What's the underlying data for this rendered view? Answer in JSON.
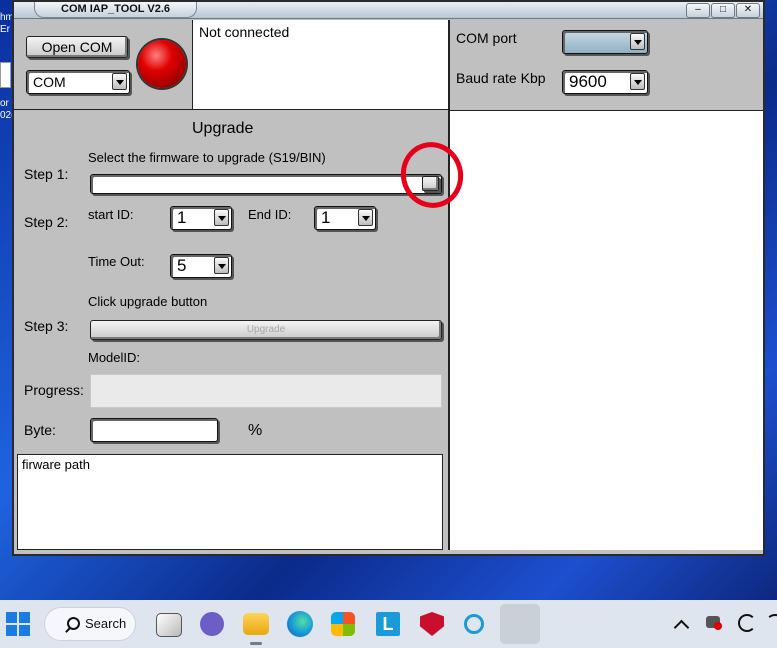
{
  "desktop": {
    "fragments": [
      "hm",
      "Er",
      "or l",
      "02("
    ]
  },
  "window": {
    "title": "COM IAP_TOOL V2.6",
    "controls": {
      "minimize": "–",
      "maximize": "□",
      "close": "✕"
    }
  },
  "connection": {
    "open_com_label": "Open COM",
    "com_select_value": "COM",
    "status_text": "Not connected",
    "status_color": "#d40000"
  },
  "port_settings": {
    "com_port_label": "COM port",
    "com_port_value": "",
    "baud_rate_label": "Baud rate Kbp",
    "baud_rate_value": "9600"
  },
  "upgrade": {
    "heading": "Upgrade",
    "step1_label": "Step 1:",
    "step1_text": "Select the firmware  to upgrade (S19/BIN)",
    "firmware_path_value": "",
    "step2_label": "Step 2:",
    "start_id_label": "start ID:",
    "start_id_value": "1",
    "end_id_label": "End ID:",
    "end_id_value": "1",
    "timeout_label": "Time Out:",
    "timeout_value": "5",
    "step3_label": "Step 3:",
    "step3_text": "Click upgrade button",
    "upgrade_button_label": "Upgrade",
    "model_id_label": "ModelID:",
    "progress_label": "Progress:",
    "progress_value": 0,
    "byte_label": "Byte:",
    "byte_value": "",
    "percent_label": "%",
    "log_text": "firware path"
  },
  "taskbar": {
    "search_label": "Search",
    "icons": [
      "windows-start-icon",
      "search-icon",
      "task-view-icon",
      "chat-icon",
      "file-explorer-icon",
      "edge-icon",
      "store-icon",
      "l-app-icon",
      "mcafee-icon",
      "cortana-icon",
      "iap-tool-icon"
    ],
    "tray_icons": [
      "chevron-up-icon",
      "network-error-icon",
      "sync-icon",
      "wifi-icon"
    ]
  }
}
